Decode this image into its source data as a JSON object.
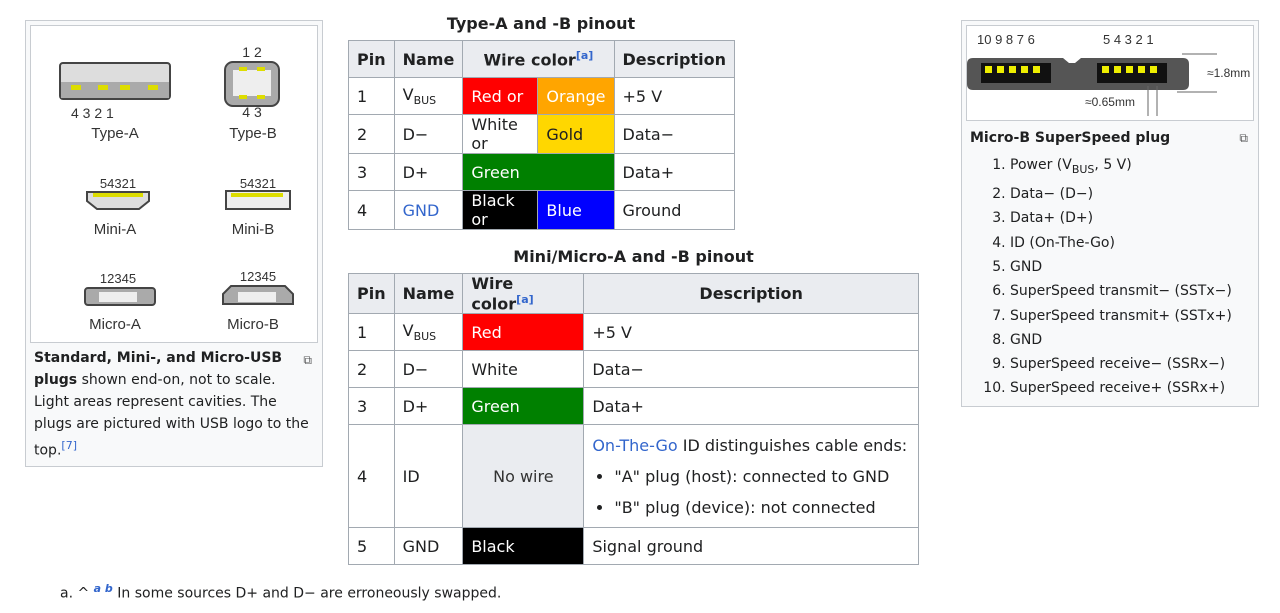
{
  "left_figure": {
    "labels": {
      "type_a": "Type-A",
      "type_b": "Type-B",
      "mini_a": "Mini-A",
      "mini_b": "Mini-B",
      "micro_a": "Micro-A",
      "micro_b": "Micro-B",
      "type_a_pins": "4 3 2 1",
      "type_b_top": "1 2",
      "type_b_bottom": "4 3",
      "mini_pins": "54321",
      "micro_pins": "12345"
    },
    "caption_bold": "Standard, Mini-, and Micro-USB plugs",
    "caption_rest": " shown end-on, not to scale. Light areas represent cavities. The plugs are pictured with USB logo to the top.",
    "caption_ref": "[7]"
  },
  "table1": {
    "title": "Type-A and -B pinout",
    "headers": [
      "Pin",
      "Name",
      "Wire color",
      "Description"
    ],
    "header_ref": "[a]",
    "rows": [
      {
        "pin": "1",
        "name": "V",
        "name_sub": "BUS",
        "c1": "Red or",
        "c2": "Orange",
        "desc": "+5 V"
      },
      {
        "pin": "2",
        "name": "D−",
        "c1": "White or",
        "c2": "Gold",
        "desc": "Data−"
      },
      {
        "pin": "3",
        "name": "D+",
        "c1": "Green",
        "desc": "Data+"
      },
      {
        "pin": "4",
        "name": "GND",
        "c1": "Black or",
        "c2": "Blue",
        "desc": "Ground"
      }
    ]
  },
  "table2": {
    "title": "Mini/Micro-A and -B pinout",
    "headers": [
      "Pin",
      "Name",
      "Wire color",
      "Description"
    ],
    "header_ref": "[a]",
    "rows": [
      {
        "pin": "1",
        "name": "V",
        "name_sub": "BUS",
        "color": "Red",
        "desc": "+5 V"
      },
      {
        "pin": "2",
        "name": "D−",
        "color": "White",
        "desc": "Data−"
      },
      {
        "pin": "3",
        "name": "D+",
        "color": "Green",
        "desc": "Data+"
      },
      {
        "pin": "4",
        "name": "ID",
        "color": "No wire",
        "desc_link": "On-The-Go",
        "desc": " ID distinguishes cable ends:",
        "bullets": [
          "\"A\" plug (host): connected to GND",
          "\"B\" plug (device): not connected"
        ]
      },
      {
        "pin": "5",
        "name": "GND",
        "color": "Black",
        "desc": "Signal ground"
      }
    ]
  },
  "right_figure": {
    "pins_left": "10 9 8 7 6",
    "pins_right": "5 4 3 2 1",
    "dim_h": "≈1.8mm",
    "dim_w": "≈0.65mm",
    "caption": "Micro-B SuperSpeed plug",
    "list": [
      "Power (V|BUS|, 5 V)",
      "Data− (D−)",
      "Data+ (D+)",
      "ID (On-The-Go)",
      "GND",
      "SuperSpeed transmit− (SSTx−)",
      "SuperSpeed transmit+ (SSTx+)",
      "GND",
      "SuperSpeed receive− (SSRx−)",
      "SuperSpeed receive+ (SSRx+)"
    ]
  },
  "footnote": {
    "marker": "a.",
    "caret": "^",
    "refs": "a b",
    "text": " In some sources D+ and D− are erroneously swapped."
  },
  "colors": {
    "red": "#ff0000",
    "orange": "#ffa500",
    "gold": "#ffd700",
    "green": "#008000",
    "black": "#000000",
    "blue": "#0000ff",
    "link": "#3366cc"
  }
}
